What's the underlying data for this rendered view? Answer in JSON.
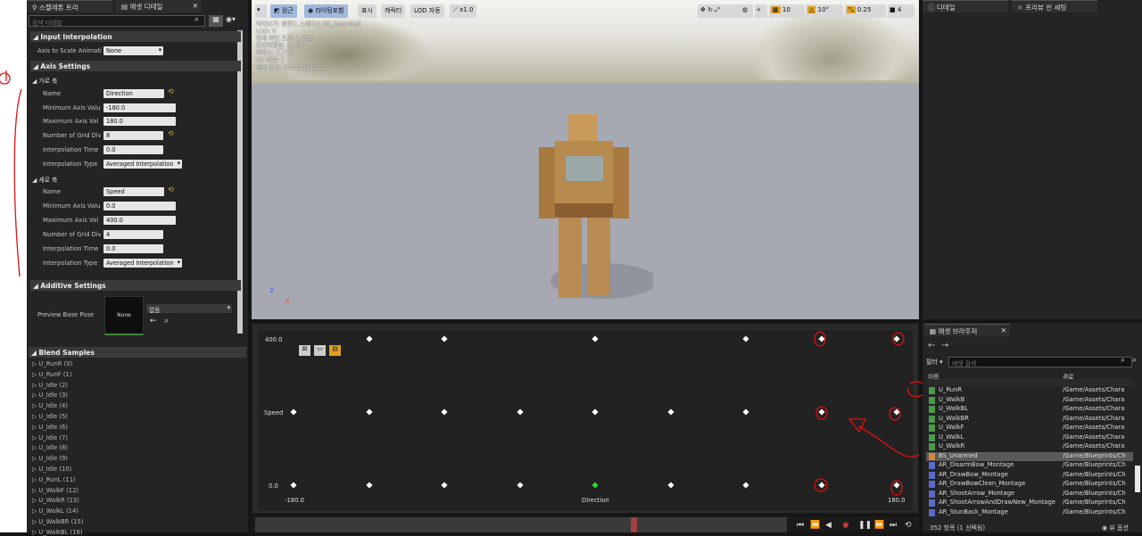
{
  "colors": {
    "annotation": "#e01010",
    "accent": "#e0b24a",
    "sample_active": "#22dd22"
  },
  "left_tabs": [
    {
      "label": "스켈레톤 트리",
      "icon": "skeleton-icon"
    },
    {
      "label": "애셋 디테일",
      "icon": "details-icon"
    }
  ],
  "details": {
    "search_placeholder": "검색 디테일",
    "input_interpolation": {
      "title": "Input Interpolation",
      "axis_label": "Axis to Scale Animati",
      "axis_value": "None"
    },
    "axis_settings": {
      "title": "Axis Settings",
      "horizontal": {
        "title": "가로 축",
        "name_label": "Name",
        "name_value": "Direction",
        "min_label": "Minimum Axis Valu",
        "min_value": "-180.0",
        "max_label": "Maximum Axis Val",
        "max_value": "180.0",
        "grid_label": "Number of Grid Divi",
        "grid_value": "8",
        "interp_time_label": "Interpolation Time",
        "interp_time_value": "0.0",
        "interp_type_label": "Interpolation Type",
        "interp_type_value": "Averaged Interpolation"
      },
      "vertical": {
        "title": "세로 축",
        "name_label": "Name",
        "name_value": "Speed",
        "min_label": "Minimum Axis Valu",
        "min_value": "0.0",
        "max_label": "Maximum Axis Val",
        "max_value": "400.0",
        "grid_label": "Number of Grid Divi",
        "grid_value": "4",
        "interp_time_label": "Interpolation Time",
        "interp_time_value": "0.0",
        "interp_type_label": "Interpolation Type",
        "interp_type_value": "Averaged Interpolation"
      }
    },
    "additive": {
      "title": "Additive Settings",
      "preview_label": "Preview Base Pose",
      "thumb_label": "None",
      "asset_value": "없음"
    },
    "blend_samples": {
      "title": "Blend Samples",
      "items": [
        "U_RunR (0)",
        "U_RunF (1)",
        "U_Idle (2)",
        "U_Idle (3)",
        "U_Idle (4)",
        "U_Idle (5)",
        "U_Idle (6)",
        "U_Idle (7)",
        "U_Idle (8)",
        "U_Idle (9)",
        "U_Idle (10)",
        "U_RunL (11)",
        "U_WalkF (12)",
        "U_WalkR (13)",
        "U_WalkL (14)",
        "U_WalkBR (15)",
        "U_WalkBL (16)"
      ]
    }
  },
  "viewport": {
    "toolbar": {
      "perspective": "원근",
      "lit": "라이팅포함",
      "show": "표시",
      "character": "캐릭터",
      "lod": "LOD 자동",
      "speed": "x1.0",
      "grid_value": "10",
      "angle_value": "10°",
      "scale_value": "0.25",
      "camera_speed": "4"
    },
    "info_lines": [
      "미리보기: 블렌드 스페이스 BS_Unarmed",
      "LOD: 0",
      "현재 화면 크기: 1.002",
      "트라이앵글: 3,756",
      "버텍스: 2,714",
      "UV 채널: 1",
      "대략 크기: 274x100x285"
    ]
  },
  "blend_space": {
    "y_max_label": "400.0",
    "y_mid_label": "Speed",
    "y_min_label": "0.0",
    "x_min_label": "-180.0",
    "x_mid_label": "Direction",
    "x_max_label": "180.0",
    "x_range": [
      -180,
      180
    ],
    "y_range": [
      0,
      400
    ],
    "samples": [
      {
        "x": -135,
        "y": 400
      },
      {
        "x": -90,
        "y": 400
      },
      {
        "x": 0,
        "y": 400
      },
      {
        "x": 90,
        "y": 400
      },
      {
        "x": 135,
        "y": 400
      },
      {
        "x": 180,
        "y": 400
      },
      {
        "x": -180,
        "y": 200
      },
      {
        "x": -135,
        "y": 200
      },
      {
        "x": -90,
        "y": 200
      },
      {
        "x": -45,
        "y": 200
      },
      {
        "x": 0,
        "y": 200
      },
      {
        "x": 45,
        "y": 200
      },
      {
        "x": 90,
        "y": 200
      },
      {
        "x": 135,
        "y": 200
      },
      {
        "x": 180,
        "y": 200
      },
      {
        "x": -180,
        "y": 0
      },
      {
        "x": -135,
        "y": 0
      },
      {
        "x": -90,
        "y": 0
      },
      {
        "x": -45,
        "y": 0
      },
      {
        "x": 0,
        "y": 0,
        "active": true
      },
      {
        "x": 45,
        "y": 0
      },
      {
        "x": 90,
        "y": 0
      },
      {
        "x": 135,
        "y": 0
      },
      {
        "x": 180,
        "y": 0
      }
    ]
  },
  "right_tabs": [
    {
      "label": "디테일",
      "icon": "details-icon"
    },
    {
      "label": "프리뷰 씬 세팅",
      "icon": "scene-icon"
    }
  ],
  "asset_browser": {
    "tab": "애셋 브라우저",
    "filter_label": "필터",
    "search_placeholder": "애셋 검색",
    "col_name": "이름",
    "col_path": "경로",
    "rows": [
      {
        "name": "U_RunR",
        "path": "/Game/Assets/Chara",
        "type": "anim"
      },
      {
        "name": "U_WalkB",
        "path": "/Game/Assets/Chara",
        "type": "anim"
      },
      {
        "name": "U_WalkBL",
        "path": "/Game/Assets/Chara",
        "type": "anim"
      },
      {
        "name": "U_WalkBR",
        "path": "/Game/Assets/Chara",
        "type": "anim"
      },
      {
        "name": "U_WalkF",
        "path": "/Game/Assets/Chara",
        "type": "anim"
      },
      {
        "name": "U_WalkL",
        "path": "/Game/Assets/Chara",
        "type": "anim"
      },
      {
        "name": "U_WalkR",
        "path": "/Game/Assets/Chara",
        "type": "anim"
      },
      {
        "name": "BS_Unarmed",
        "path": "/Game/Blueprints/Ch",
        "type": "blendspace",
        "selected": true
      },
      {
        "name": "AR_DisarmBow_Montage",
        "path": "/Game/Blueprints/Ch",
        "type": "montage"
      },
      {
        "name": "AR_DrawBow_Montage",
        "path": "/Game/Blueprints/Ch",
        "type": "montage"
      },
      {
        "name": "AR_DrawBowClean_Montage",
        "path": "/Game/Blueprints/Ch",
        "type": "montage"
      },
      {
        "name": "AR_ShootArrow_Montage",
        "path": "/Game/Blueprints/Ch",
        "type": "montage"
      },
      {
        "name": "AR_ShootArrowAndDrawNew_Montage",
        "path": "/Game/Blueprints/Ch",
        "type": "montage"
      },
      {
        "name": "AR_StunBack_Montage",
        "path": "/Game/Blueprints/Ch",
        "type": "montage"
      }
    ],
    "status": "352 항목 (1 선택됨)",
    "view_options": "뷰 옵션"
  }
}
